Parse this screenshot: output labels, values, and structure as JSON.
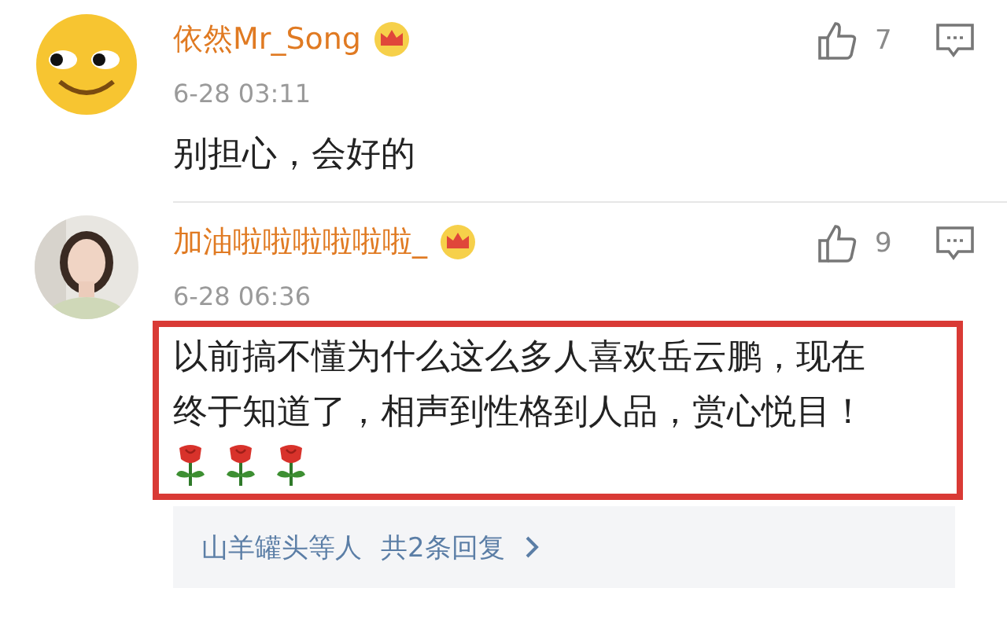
{
  "comments": [
    {
      "avatar": {
        "kind": "emoji"
      },
      "name": "依然Mr_Song",
      "time": "6-28 03:11",
      "likes": "7",
      "text": "别担心，会好的",
      "highlighted": false
    },
    {
      "name": "加油啦啦啦啦啦啦_",
      "time": "6-28 06:36",
      "likes": "9",
      "text": "以前搞不懂为什么这么多人喜欢岳云鹏，现在终于知道了，相声到性格到人品，赏心悦目！",
      "highlighted": true,
      "emojis": [
        {
          "kind": "rose"
        },
        {
          "kind": "rose"
        },
        {
          "kind": "rose"
        }
      ],
      "replies": {
        "users": "山羊罐头等人",
        "count": "共2条回复"
      }
    }
  ]
}
